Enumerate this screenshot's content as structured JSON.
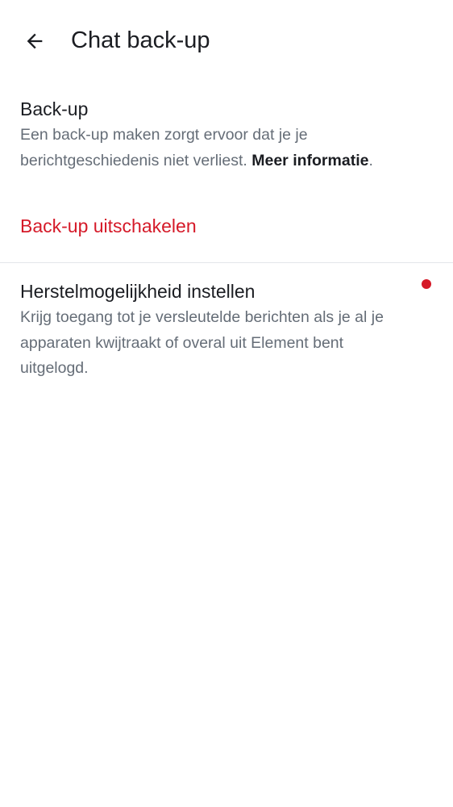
{
  "header": {
    "title": "Chat back-up",
    "back_icon": "arrow-left-icon"
  },
  "backup": {
    "title": "Back-up",
    "description": "Een back-up maken zorgt ervoor dat je je berichtgeschiedenis niet verliest. ",
    "link_text": "Meer informatie",
    "link_suffix": "."
  },
  "disable": {
    "label": "Back-up uitschakelen"
  },
  "recovery": {
    "title": "Herstelmogelijkheid instellen",
    "description": "Krijg toegang tot je versleutelde berichten als je al je apparaten kwijtraakt of overal uit Element bent uitgelogd.",
    "indicator_icon": "red-dot-icon"
  },
  "colors": {
    "accent_critical": "#d51928",
    "text_primary": "#1b1d22",
    "text_secondary": "#656d77",
    "divider": "#e3e6ea"
  }
}
